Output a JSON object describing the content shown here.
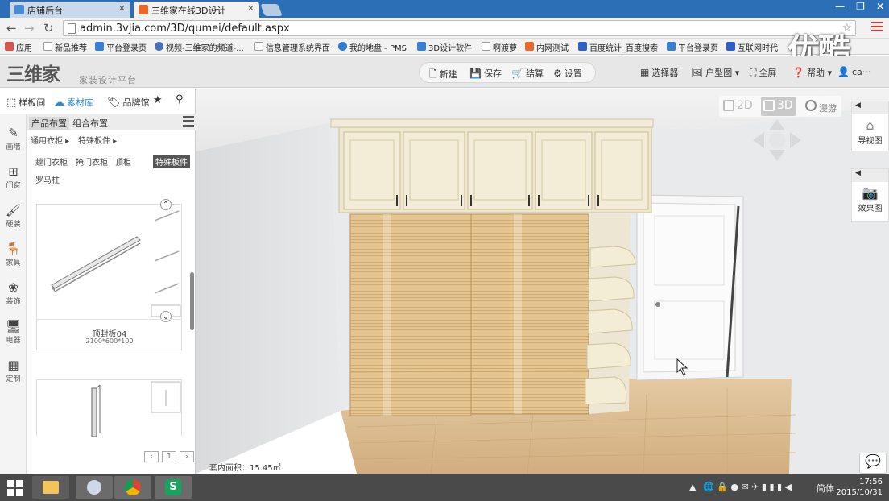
{
  "browser": {
    "tabs": [
      {
        "label": "店铺后台",
        "active": false
      },
      {
        "label": "三维家在线3D设计",
        "active": true
      }
    ],
    "url": "admin.3vjia.com/3D/qumei/default.aspx",
    "bookmarks": [
      "应用",
      "新品推荐",
      "平台登录页",
      "视频-三维家的频道-...",
      "信息管理系统界面",
      "我的地盘 - PMS",
      "3D设计软件",
      "啊渡萝",
      "内网测试",
      "百度统计_百度搜索",
      "平台登录页",
      "互联网时代"
    ],
    "watermark": "优酷"
  },
  "app": {
    "logo": "三维家",
    "subtitle": "家装设计平台",
    "toolbar": {
      "new": "新建",
      "save": "保存",
      "checkout": "结算",
      "settings": "设置"
    },
    "right_tools": {
      "selector": "选择器",
      "floorplan": "户型图",
      "fullscreen": "全屏",
      "help": "帮助",
      "user": "ca···"
    }
  },
  "left_panel": {
    "tabs": [
      "样板间",
      "素材库",
      "品牌馆"
    ],
    "rail": [
      "画墙",
      "门窗",
      "硬装",
      "家具",
      "装饰",
      "电器",
      "定制"
    ],
    "subtabs": [
      "产品布置",
      "组合布置"
    ],
    "breadcrumb": [
      "通用衣柜",
      "特殊板件"
    ],
    "categories": [
      "趟门衣柜",
      "掩门衣柜",
      "顶柜",
      "特殊板件",
      "罗马柱"
    ],
    "selected_category": "特殊板件",
    "cards": [
      {
        "name": "顶封板04",
        "dims": "2100*600*100"
      },
      {
        "name": "",
        "dims": ""
      }
    ],
    "pager": {
      "prev": "‹",
      "page": "1",
      "next": "›"
    }
  },
  "viewport": {
    "view_modes": [
      "2D",
      "3D",
      "漫游"
    ],
    "active_mode": "3D",
    "side_cards": [
      {
        "head": "◀",
        "label": "导视图"
      },
      {
        "head": "◀",
        "label": "效果图"
      }
    ],
    "area_label": "套内面积：15.45㎡"
  },
  "taskbar": {
    "ime": "简体",
    "time": "17:56",
    "date": "2015/10/31"
  },
  "colors": {
    "accent": "#2d8ad6",
    "tabbar": "#2c6fb7",
    "selected_cat": "#555555"
  }
}
